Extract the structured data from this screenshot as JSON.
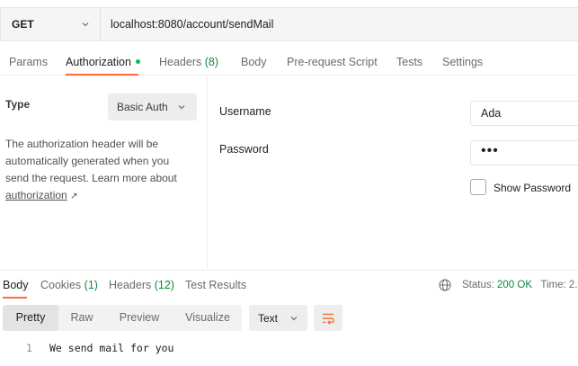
{
  "request": {
    "method": "GET",
    "url": "localhost:8080/account/sendMail"
  },
  "request_tabs": [
    {
      "label": "Params"
    },
    {
      "label": "Authorization",
      "active": true,
      "indicator": "green-dot"
    },
    {
      "label": "Headers",
      "count": "(8)"
    },
    {
      "label": "Body"
    },
    {
      "label": "Pre-request Script"
    },
    {
      "label": "Tests"
    },
    {
      "label": "Settings"
    }
  ],
  "auth": {
    "type_label": "Type",
    "type_value": "Basic Auth",
    "description": "The authorization header will be automatically generated when you send the request. Learn more about ",
    "link_text": "authorization",
    "link_arrow": "↗",
    "username_label": "Username",
    "username_value": "Ada",
    "password_label": "Password",
    "password_value": "•••",
    "show_password_label": "Show Password",
    "show_password_checked": false
  },
  "response_tabs": [
    {
      "label": "Body",
      "active": true
    },
    {
      "label": "Cookies",
      "count": "(1)"
    },
    {
      "label": "Headers",
      "count": "(12)"
    },
    {
      "label": "Test Results"
    }
  ],
  "status": {
    "label": "Status:",
    "value": "200 OK",
    "time_label": "Time: 2."
  },
  "response_view": {
    "options": [
      "Pretty",
      "Raw",
      "Preview",
      "Visualize"
    ],
    "active": "Pretty",
    "format": "Text"
  },
  "response_body": [
    {
      "line": "1",
      "text": "We send mail for you"
    }
  ],
  "colors": {
    "accent": "#ff6c37",
    "success": "#0c8a3a",
    "dot": "#0cbb52"
  }
}
